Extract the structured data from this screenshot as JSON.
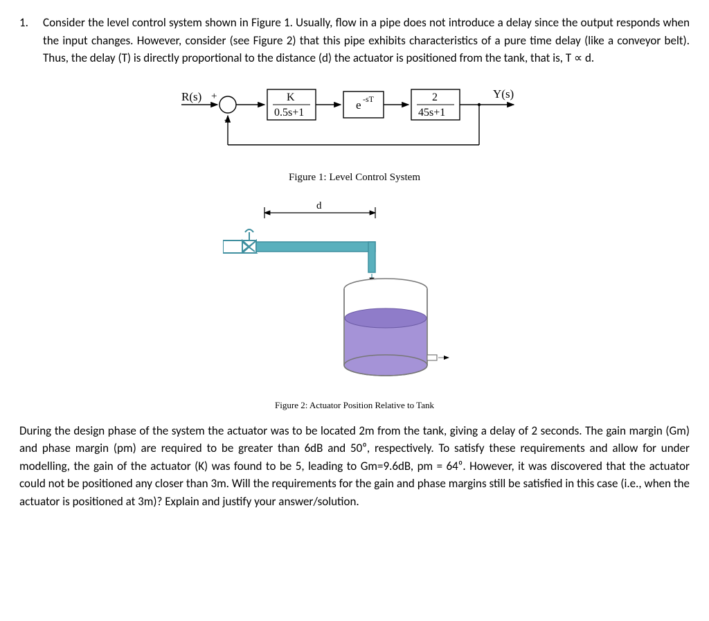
{
  "question_number": "1.",
  "para1": "Consider the level control system shown in Figure 1. Usually, flow in a pipe does not introduce a delay since the output responds when the input changes. However, consider (see Figure 2) that this pipe exhibits characteristics of a pure time delay (like a conveyor belt). Thus, the delay (T) is directly proportional to the distance (d) the actuator is positioned from the tank, that is, T ∝ d.",
  "fig1_caption": "Figure 1: Level Control System",
  "fig2_caption": "Figure 2: Actuator Position Relative to Tank",
  "para2": "During the design phase of the system the actuator was to be located 2m from the tank, giving a delay of 2 seconds. The gain margin (Gm) and phase margin (pm) are required to be greater than 6dB and 50⁰, respectively. To satisfy these requirements and allow for under modelling, the gain of the actuator (K) was found to be 5, leading to Gm=9.6dB, pm = 64⁰. However, it was discovered that the actuator could not be positioned any closer than 3m. Will the requirements for the gain and phase margins still be satisfied in this case (i.e., when the actuator is positioned at 3m)? Explain and justify your answer/solution.",
  "block_diagram": {
    "input": "R(s)",
    "sum_plus": "+",
    "sum_minus": "-",
    "g1_num": "K",
    "g1_den": "0.5s+1",
    "g2": "e",
    "g2_sup": "-sT",
    "g3_num": "2",
    "g3_den": "45s+1",
    "output": "Y(s)"
  },
  "actuator": {
    "d_label": "d"
  }
}
